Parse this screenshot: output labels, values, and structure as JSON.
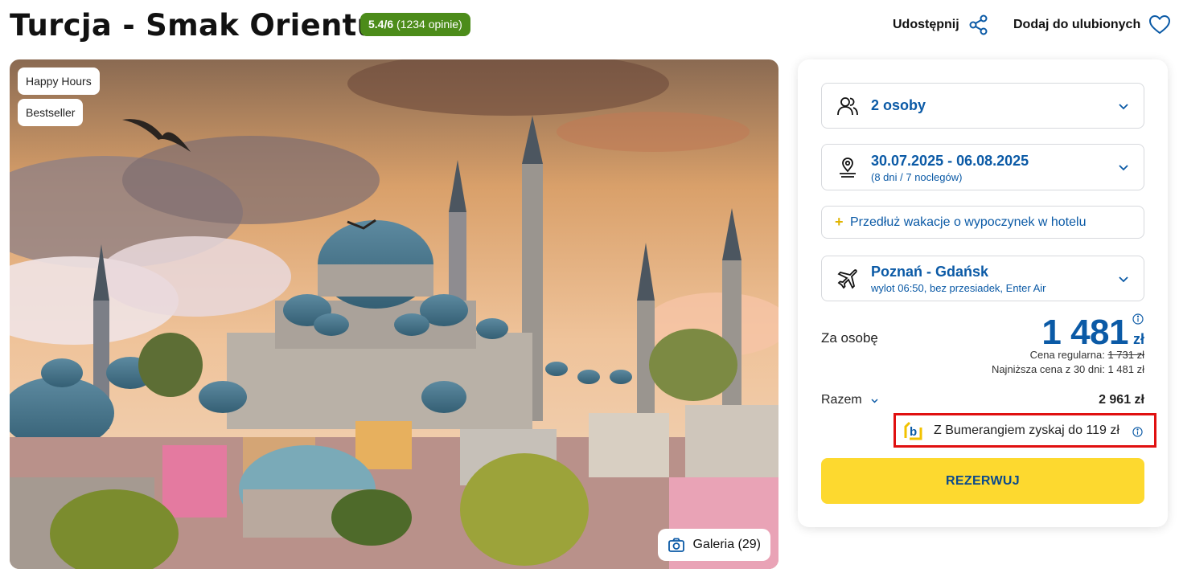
{
  "header": {
    "title": "Turcja - Smak Orientu",
    "rating_score": "5.4/6",
    "rating_count": "(1234 opinie)",
    "share_label": "Udostępnij",
    "favorite_label": "Dodaj do ulubionych"
  },
  "photo": {
    "tags": [
      "Happy Hours",
      "Bestseller"
    ],
    "gallery_label": "Galeria (29)"
  },
  "booking": {
    "persons": "2 osoby",
    "dates": "30.07.2025 - 06.08.2025",
    "duration": "(8 dni / 7 noclegów)",
    "extend_label": "Przedłuż wakacje o wypoczynek w hotelu",
    "route": "Poznań - Gdańsk",
    "flight_info": "wylot 06:50, bez przesiadek, Enter Air",
    "per_person_label": "Za osobę",
    "price_amount": "1 481",
    "price_currency": "zł",
    "regular_label": "Cena regularna:",
    "regular_price": "1 731 zł",
    "lowest_label": "Najniższa cena z 30 dni: 1 481 zł",
    "total_label": "Razem",
    "total_value": "2 961 zł",
    "bumerang_label": "Z Bumerangiem zyskaj do 119 zł",
    "reserve_label": "REZERWUJ"
  },
  "colors": {
    "accent_blue": "#0b5aa6",
    "rating_green": "#4c8c1a",
    "reserve_yellow": "#fdd92f",
    "highlight_red": "#e01010"
  }
}
